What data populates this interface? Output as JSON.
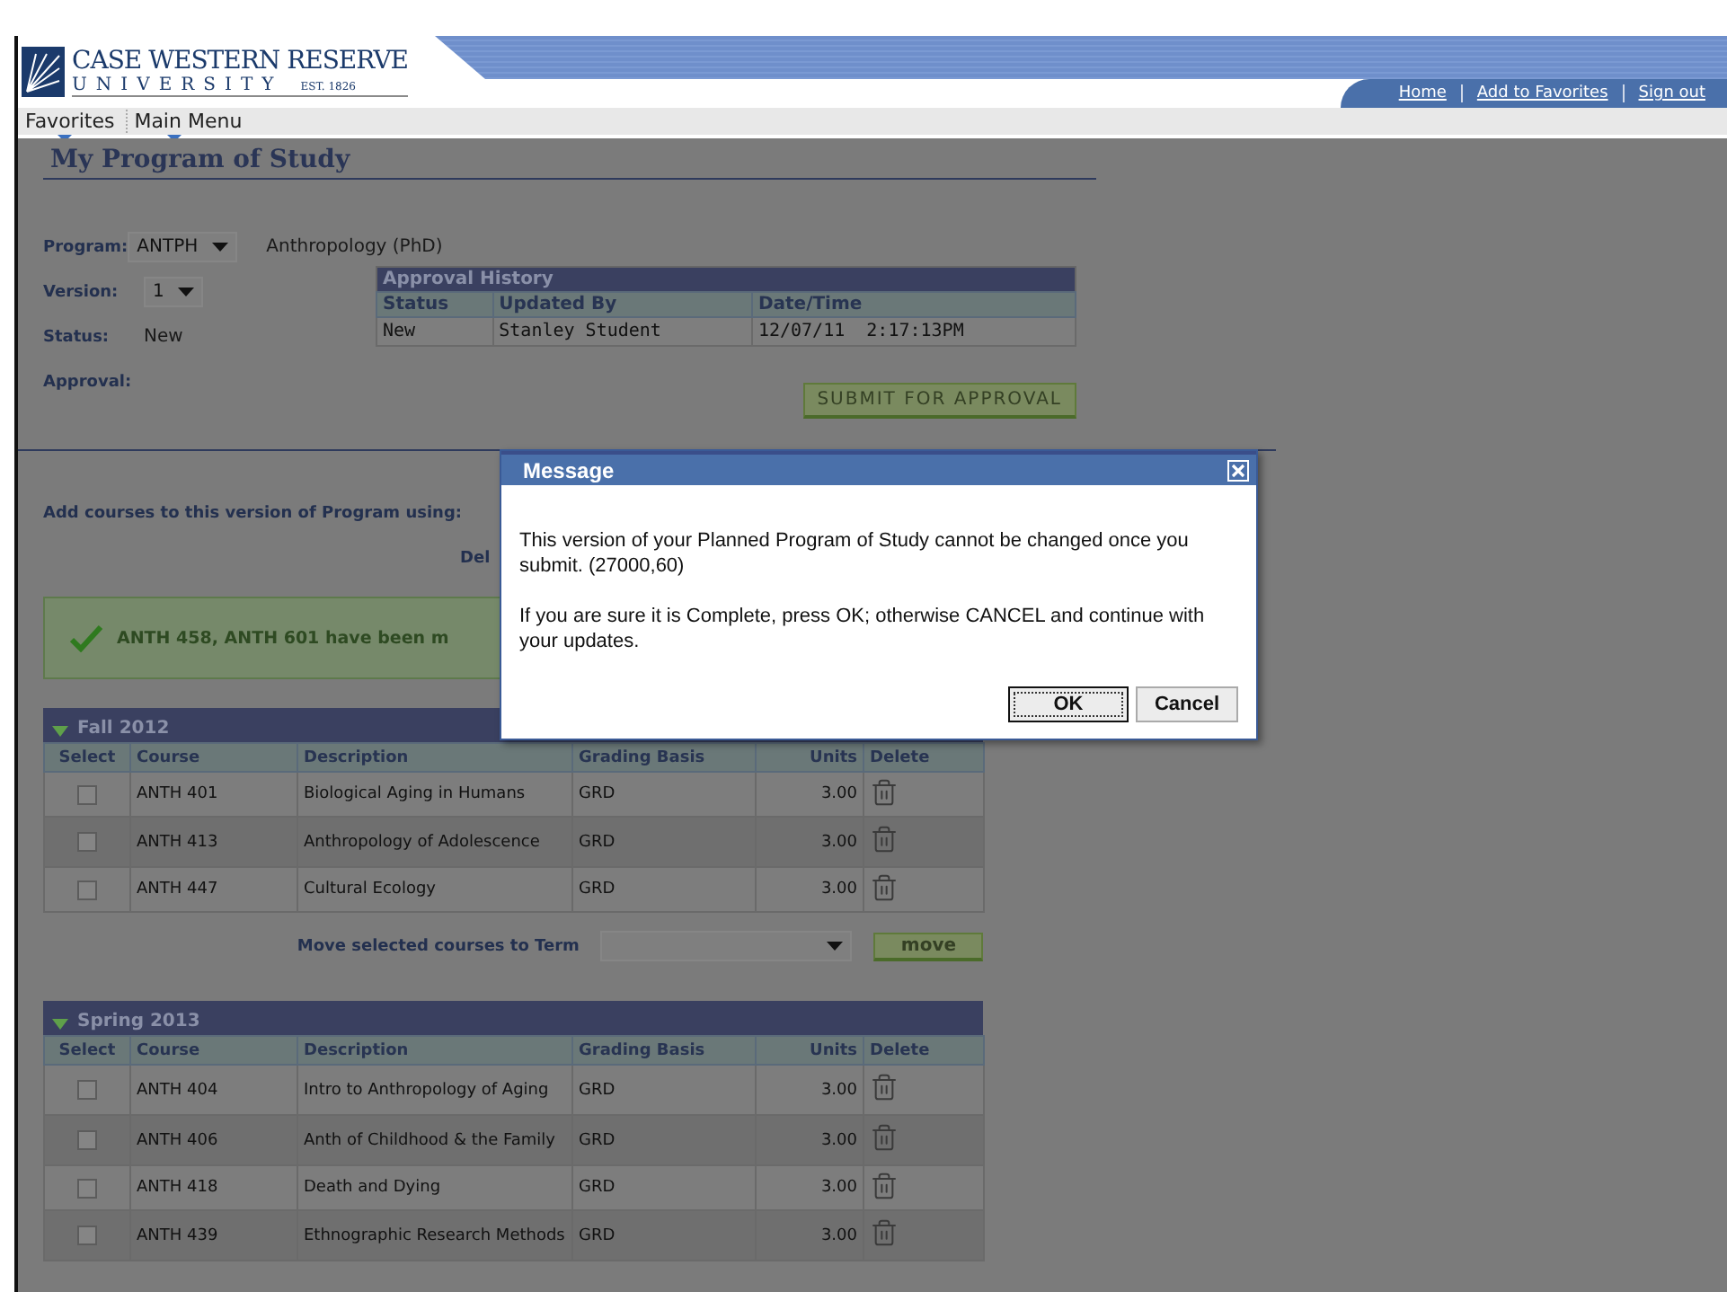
{
  "header": {
    "logo": {
      "name": "CASE WESTERN RESERVE",
      "sub": "UNIVERSITY",
      "est": "EST. 1826"
    },
    "links": [
      "Home",
      "Add to Favorites",
      "Sign out"
    ]
  },
  "nav": [
    "Favorites",
    "Main Menu"
  ],
  "page_title": "My Program of Study",
  "fields": [
    {
      "label": "Program:",
      "kind": "select",
      "value": "ANTPH",
      "note": "Anthropology (PhD)"
    },
    {
      "label": "Version:",
      "kind": "select",
      "value": "1"
    },
    {
      "label": "Status:",
      "kind": "text",
      "value": "New"
    },
    {
      "label": "Approval:",
      "kind": "text"
    }
  ],
  "approval_history": {
    "title": "Approval History",
    "columns": [
      "Status",
      "Updated By",
      "Date/Time"
    ],
    "rows": [
      [
        "New",
        "Stanley Student",
        "12/07/11  2:17:13PM"
      ]
    ]
  },
  "submit_button": "SUBMIT FOR APPROVAL",
  "add_courses": {
    "label": "Add courses to this version of Program using:",
    "partial": "Del"
  },
  "success_message": "ANTH 458, ANTH 601 have been m",
  "terms": [
    {
      "title": "Fall 2012",
      "expanded": true,
      "columns": [
        "Select",
        "Course",
        "Description",
        "Grading Basis",
        "Units",
        "Delete"
      ],
      "rows": [
        {
          "checked": false,
          "course": "ANTH 401",
          "description": "Biological Aging in Humans",
          "grading": "GRD",
          "units": "3.00"
        },
        {
          "checked": false,
          "course": "ANTH 413",
          "description": "Anthropology of Adolescence",
          "grading": "GRD",
          "units": "3.00"
        },
        {
          "checked": false,
          "course": "ANTH 447",
          "description": "Cultural Ecology",
          "grading": "GRD",
          "units": "3.00"
        }
      ],
      "move": {
        "label": "Move selected courses to Term",
        "button": "move"
      }
    },
    {
      "title": "Spring 2013",
      "expanded": true,
      "columns": [
        "Select",
        "Course",
        "Description",
        "Grading Basis",
        "Units",
        "Delete"
      ],
      "rows": [
        {
          "checked": false,
          "course": "ANTH 404",
          "description": "Intro to Anthropology of Aging",
          "grading": "GRD",
          "units": "3.00"
        },
        {
          "checked": false,
          "course": "ANTH 406",
          "description": "Anth of Childhood & the Family",
          "grading": "GRD",
          "units": "3.00"
        },
        {
          "checked": false,
          "course": "ANTH 418",
          "description": "Death and Dying",
          "grading": "GRD",
          "units": "3.00"
        },
        {
          "checked": false,
          "course": "ANTH 439",
          "description": "Ethnographic Research Methods",
          "grading": "GRD",
          "units": "3.00"
        }
      ]
    }
  ],
  "dialog": {
    "title": "Message",
    "paragraphs": [
      "This version of your Planned Program of Study cannot be changed once you submit. (27000,60)",
      "If you are sure it is Complete, press OK; otherwise CANCEL and continue with your updates."
    ],
    "buttons": [
      {
        "label": "OK",
        "focused": true
      },
      {
        "label": "Cancel",
        "focused": false
      }
    ]
  }
}
